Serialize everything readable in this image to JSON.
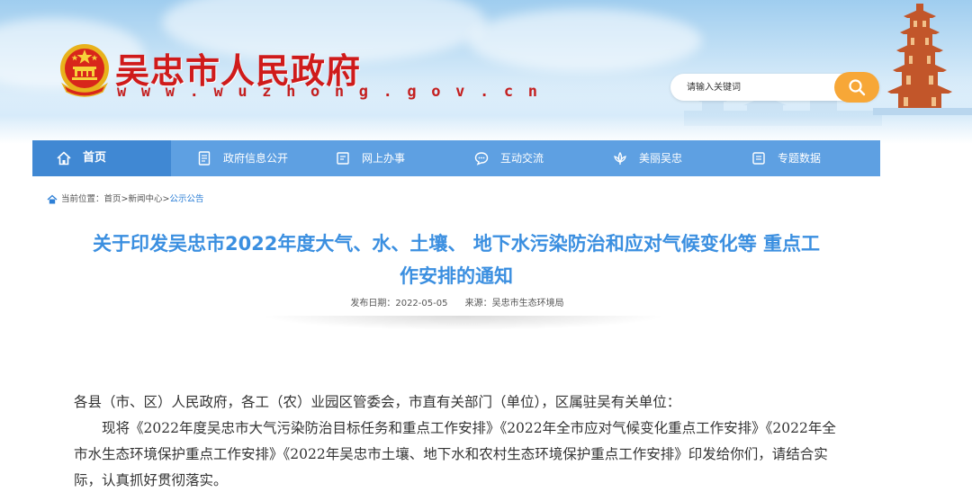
{
  "header": {
    "site_title": "吴忠市人民政府",
    "site_url": "w w w . w u z h o n g . g o v . c n",
    "search": {
      "placeholder": "请输入关键词"
    }
  },
  "nav": {
    "items": [
      {
        "label": "首页",
        "icon": "home-icon",
        "active": true
      },
      {
        "label": "政府信息公开",
        "icon": "document-icon",
        "active": false
      },
      {
        "label": "网上办事",
        "icon": "folder-icon",
        "active": false
      },
      {
        "label": "互动交流",
        "icon": "chat-icon",
        "active": false
      },
      {
        "label": "美丽吴忠",
        "icon": "lotus-icon",
        "active": false
      },
      {
        "label": "专题数据",
        "icon": "data-icon",
        "active": false
      }
    ]
  },
  "breadcrumb": {
    "prefix": "当前位置：",
    "items": [
      "首页",
      "新闻中心",
      "公示公告"
    ],
    "separator": ">"
  },
  "article": {
    "title_line1": "关于印发吴忠市2022年度大气、水、土壤、 地下水污染防治和应对气候变化等 重点工",
    "title_line2": "作安排的通知",
    "publish_date": "发布日期：2022-05-05",
    "source": "来源：吴忠市生态环境局",
    "paragraph1": "各县（市、区）人民政府，各工（农）业园区管委会，市直有关部门（单位），区属驻吴有关单位：",
    "paragraph2": "现将《2022年度吴忠市大气污染防治目标任务和重点工作安排》《2022年全市应对气候变化重点工作安排》《2022年全市水生态环境保护重点工作安排》《2022年吴忠市土壤、地下水和农村生态环境保护重点工作安排》印发给你们，请结合实际，认真抓好贯彻落实。"
  },
  "colors": {
    "nav_bg": "#5ea0e2",
    "nav_active": "#4088d3",
    "title_blue": "#3b8fe0",
    "site_red": "#cf1b1b",
    "search_orange": "#f7a737"
  }
}
